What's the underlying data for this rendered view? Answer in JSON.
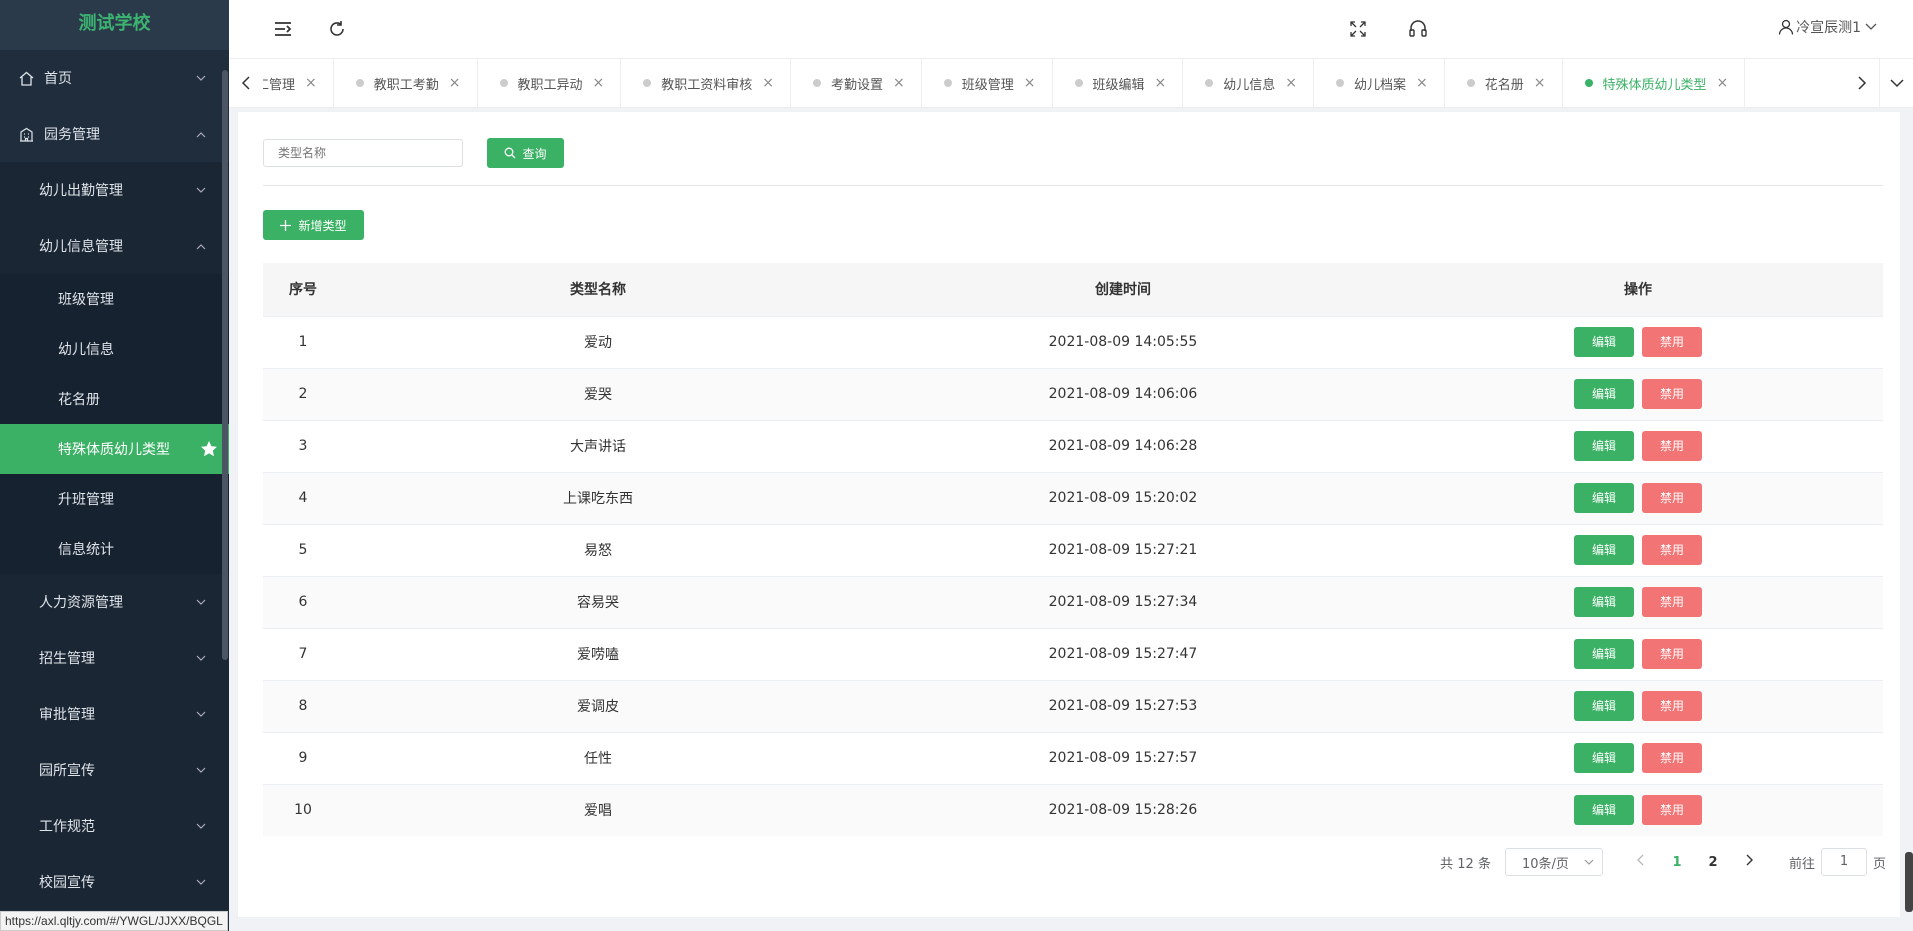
{
  "app": {
    "school_name": "测试学校",
    "status_url": "https://axl.qltjy.com/#/YWGL/JJXX/BQGL"
  },
  "header": {
    "user_name": "冷宣辰测1"
  },
  "sidebar": {
    "items": [
      {
        "label": "首页",
        "icon": "home-icon",
        "level": 0
      },
      {
        "label": "园务管理",
        "icon": "building-icon",
        "level": 0,
        "expanded": true
      },
      {
        "label": "幼儿出勤管理",
        "level": 1
      },
      {
        "label": "幼儿信息管理",
        "level": 1,
        "expanded": true
      },
      {
        "label": "班级管理",
        "level": 2
      },
      {
        "label": "幼儿信息",
        "level": 2
      },
      {
        "label": "花名册",
        "level": 2
      },
      {
        "label": "特殊体质幼儿类型",
        "level": 2,
        "active": true
      },
      {
        "label": "升班管理",
        "level": 2
      },
      {
        "label": "信息统计",
        "level": 2
      },
      {
        "label": "人力资源管理",
        "level": 1
      },
      {
        "label": "招生管理",
        "level": 1
      },
      {
        "label": "审批管理",
        "level": 1
      },
      {
        "label": "园所宣传",
        "level": 1
      },
      {
        "label": "工作规范",
        "level": 1
      },
      {
        "label": "校园宣传",
        "level": 1
      }
    ]
  },
  "tabs": [
    {
      "label": "职工管理",
      "active": false
    },
    {
      "label": "教职工考勤",
      "active": false
    },
    {
      "label": "教职工异动",
      "active": false
    },
    {
      "label": "教职工资料审核",
      "active": false
    },
    {
      "label": "考勤设置",
      "active": false
    },
    {
      "label": "班级管理",
      "active": false
    },
    {
      "label": "班级编辑",
      "active": false
    },
    {
      "label": "幼儿信息",
      "active": false
    },
    {
      "label": "幼儿档案",
      "active": false
    },
    {
      "label": "花名册",
      "active": false
    },
    {
      "label": "特殊体质幼儿类型",
      "active": true
    }
  ],
  "search": {
    "placeholder": "类型名称",
    "query_label": "查询"
  },
  "toolbar": {
    "add_label": "新增类型"
  },
  "table": {
    "columns": [
      "序号",
      "类型名称",
      "创建时间",
      "操作"
    ],
    "edit_label": "编辑",
    "disable_label": "禁用",
    "rows": [
      {
        "idx": "1",
        "name": "爱动",
        "time": "2021-08-09 14:05:55"
      },
      {
        "idx": "2",
        "name": "爱哭",
        "time": "2021-08-09 14:06:06"
      },
      {
        "idx": "3",
        "name": "大声讲话",
        "time": "2021-08-09 14:06:28"
      },
      {
        "idx": "4",
        "name": "上课吃东西",
        "time": "2021-08-09 15:20:02"
      },
      {
        "idx": "5",
        "name": "易怒",
        "time": "2021-08-09 15:27:21"
      },
      {
        "idx": "6",
        "name": "容易哭",
        "time": "2021-08-09 15:27:34"
      },
      {
        "idx": "7",
        "name": "爱唠嗑",
        "time": "2021-08-09 15:27:47"
      },
      {
        "idx": "8",
        "name": "爱调皮",
        "time": "2021-08-09 15:27:53"
      },
      {
        "idx": "9",
        "name": "任性",
        "time": "2021-08-09 15:27:57"
      },
      {
        "idx": "10",
        "name": "爱唱",
        "time": "2021-08-09 15:28:26"
      }
    ]
  },
  "pager": {
    "total": "共 12 条",
    "page_size": "10条/页",
    "pages": [
      "1",
      "2"
    ],
    "current": "1",
    "goto_prefix": "前往",
    "goto_value": "1",
    "goto_suffix": "页"
  },
  "colors": {
    "accent": "#3ab165",
    "danger": "#f27474",
    "sidebar_bg": "#1f2d3d"
  }
}
